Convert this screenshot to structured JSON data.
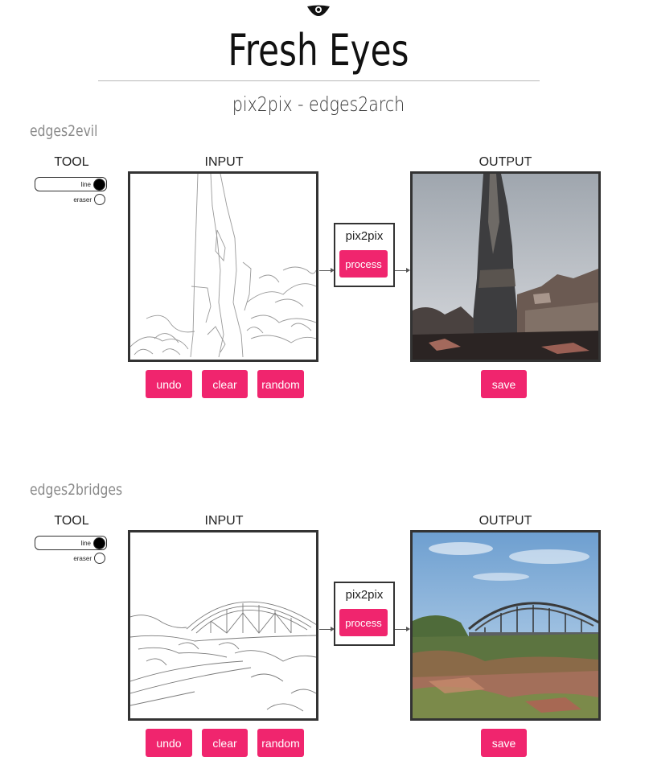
{
  "header": {
    "logo_icon": "eye-icon",
    "title": "Fresh Eyes",
    "subtitle": "pix2pix - edges2arch"
  },
  "sections": [
    {
      "title": "edges2evil",
      "tool_label": "TOOL",
      "input_label": "INPUT",
      "output_label": "OUTPUT",
      "tools": [
        {
          "label": "line",
          "selected": true
        },
        {
          "label": "eraser",
          "selected": false
        }
      ],
      "model_label": "pix2pix",
      "process_label": "process",
      "buttons": {
        "undo": "undo",
        "clear": "clear",
        "random": "random",
        "save": "save"
      }
    },
    {
      "title": "edges2bridges",
      "tool_label": "TOOL",
      "input_label": "INPUT",
      "output_label": "OUTPUT",
      "tools": [
        {
          "label": "line",
          "selected": true
        },
        {
          "label": "eraser",
          "selected": false
        }
      ],
      "model_label": "pix2pix",
      "process_label": "process",
      "buttons": {
        "undo": "undo",
        "clear": "clear",
        "random": "random",
        "save": "save"
      }
    }
  ],
  "colors": {
    "accent": "#f0256e",
    "border": "#333333",
    "section_title": "#8a8a8a"
  }
}
